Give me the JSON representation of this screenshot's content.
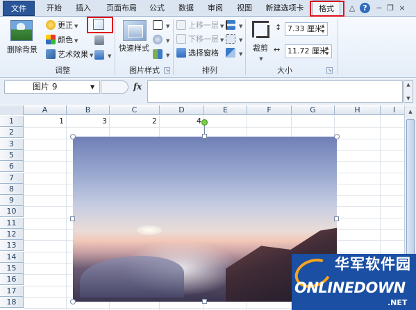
{
  "tabs": [
    {
      "id": "file",
      "label": "文件"
    },
    {
      "id": "home",
      "label": "开始"
    },
    {
      "id": "insert",
      "label": "插入"
    },
    {
      "id": "layout",
      "label": "页面布局"
    },
    {
      "id": "formulas",
      "label": "公式"
    },
    {
      "id": "data",
      "label": "数据"
    },
    {
      "id": "review",
      "label": "审阅"
    },
    {
      "id": "view",
      "label": "视图"
    },
    {
      "id": "newtab",
      "label": "新建选项卡"
    },
    {
      "id": "format",
      "label": "格式"
    }
  ],
  "active_tab": "格式",
  "window_controls": {
    "help": "?"
  },
  "ribbon": {
    "adjust": {
      "group_label": "调整",
      "remove_background": "删除背景",
      "corrections": "更正",
      "color": "颜色",
      "artistic_effects": "艺术效果"
    },
    "picture_styles": {
      "group_label": "图片样式",
      "quick_styles": "快速样式"
    },
    "arrange": {
      "group_label": "排列",
      "bring_forward": "上移一层",
      "send_backward": "下移一层",
      "selection_pane": "选择窗格"
    },
    "size": {
      "group_label": "大小",
      "crop": "裁剪",
      "height": "7.33 厘米",
      "width": "11.72 厘米"
    }
  },
  "formula_bar": {
    "name_box": "图片 9",
    "fx": "fx",
    "formula": ""
  },
  "sheet": {
    "columns": [
      "A",
      "B",
      "C",
      "D",
      "E",
      "F",
      "G",
      "H",
      "I"
    ],
    "rows": [
      "1",
      "2",
      "3",
      "5",
      "6",
      "7",
      "8",
      "9",
      "10",
      "11",
      "12",
      "13",
      "14",
      "15",
      "16",
      "17",
      "18"
    ],
    "row1_values": [
      "1",
      "3",
      "2",
      "4"
    ]
  },
  "watermark": {
    "chinese": "华军软件园",
    "english": "ONLINEDOWN",
    "suffix": ".NET"
  },
  "colors": {
    "accent": "#2a5699",
    "highlight_box": "#e0101c",
    "ribbon_bg": "#e4edf8",
    "logo_bg": "#1a4fa3",
    "logo_orange": "#f8a51b"
  }
}
